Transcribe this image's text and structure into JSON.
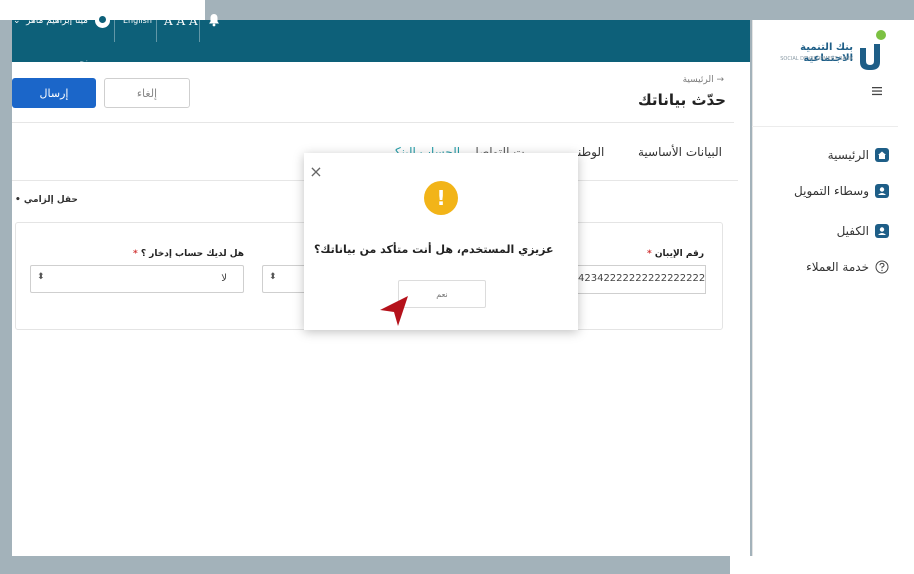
{
  "topbar": {
    "user_name": "مينا إبراهيم ماهر نجيب",
    "user_caret": "⌄",
    "language_link": "English",
    "font_size_control": "A A A"
  },
  "header": {
    "breadcrumb": "الرئيسية →",
    "title": "حدّث بياناتك",
    "send_label": "إرسال",
    "cancel_label": "إلغاء"
  },
  "tabs": [
    {
      "label": "البيانات الأساسية"
    },
    {
      "label": "العنوان الوطني"
    },
    {
      "label": "بيانات التواصل"
    },
    {
      "label": "بيانات الحساب البنكي"
    }
  ],
  "form": {
    "required_note": "حقل إلزامي",
    "iban_label": "رقم الإيبان",
    "iban_value": "42342222222222222222222",
    "savings_label": "هل لديك حساب إدخار ؟",
    "savings_value": "لا",
    "select_arrow": "⬍"
  },
  "sidebar": {
    "logo_ar": "بنك التنمية الاجتماعية",
    "logo_en": "SOCIAL DEVELOPMENT BANK",
    "items": [
      {
        "label": "الرئيسية"
      },
      {
        "label": "وسطاء التمويل"
      },
      {
        "label": "الكفيل"
      },
      {
        "label": "خدمة العملاء"
      }
    ]
  },
  "modal": {
    "close_symbol": "×",
    "warning_symbol": "!",
    "message": "عزيزي المستخدم، هل أنت متأكد من بياناتك؟",
    "yes_label": "نعم"
  },
  "colors": {
    "topbar": "#0d6079",
    "primary_button": "#1b66c9",
    "warning": "#f2b418",
    "active_tab": "#1f9aa6",
    "pointer": "#b5121b"
  }
}
